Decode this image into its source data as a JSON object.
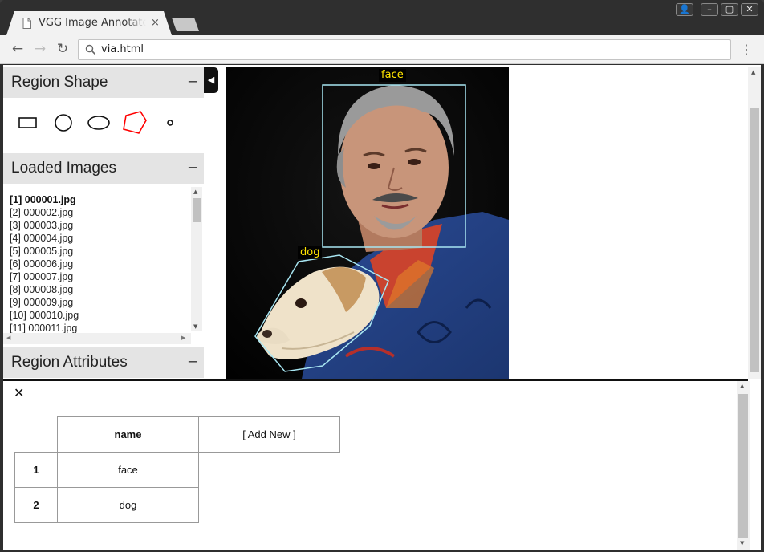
{
  "browser": {
    "tab_title": "VGG Image Annotator",
    "tab_close": "×",
    "url": "via.html",
    "window_buttons": {
      "profile": "👤",
      "minimize": "–",
      "maximize": "▢",
      "close": "✕"
    },
    "nav": {
      "back": "←",
      "forward": "→",
      "reload": "↻",
      "menu": "⋮"
    }
  },
  "left_panel": {
    "region_shape": {
      "title": "Region Shape",
      "toggle": "–",
      "shapes": [
        "rectangle-icon",
        "circle-icon",
        "ellipse-icon",
        "polygon-icon",
        "point-icon"
      ],
      "selected": "polygon",
      "selected_color": "#ff0000"
    },
    "loaded_images": {
      "title": "Loaded Images",
      "toggle": "–",
      "items": [
        "[1] 000001.jpg",
        "[2] 000002.jpg",
        "[3] 000003.jpg",
        "[4] 000004.jpg",
        "[5] 000005.jpg",
        "[6] 000006.jpg",
        "[7] 000007.jpg",
        "[8] 000008.jpg",
        "[9] 000009.jpg",
        "[10] 000010.jpg",
        "[11] 000011.jpg"
      ],
      "active_index": 0
    },
    "region_attributes": {
      "title": "Region Attributes",
      "toggle": "–"
    },
    "collapse_arrow": "◀"
  },
  "canvas": {
    "regions": [
      {
        "label": "face",
        "shape": "rect"
      },
      {
        "label": "dog",
        "shape": "polygon"
      }
    ],
    "region_stroke_color": "#a8e6f2",
    "label_color": "#ffe500"
  },
  "attributes": {
    "close": "✕",
    "header_name": "name",
    "add_new": "[ Add New ]",
    "rows": [
      {
        "num": "1",
        "name": "face"
      },
      {
        "num": "2",
        "name": "dog"
      }
    ]
  }
}
